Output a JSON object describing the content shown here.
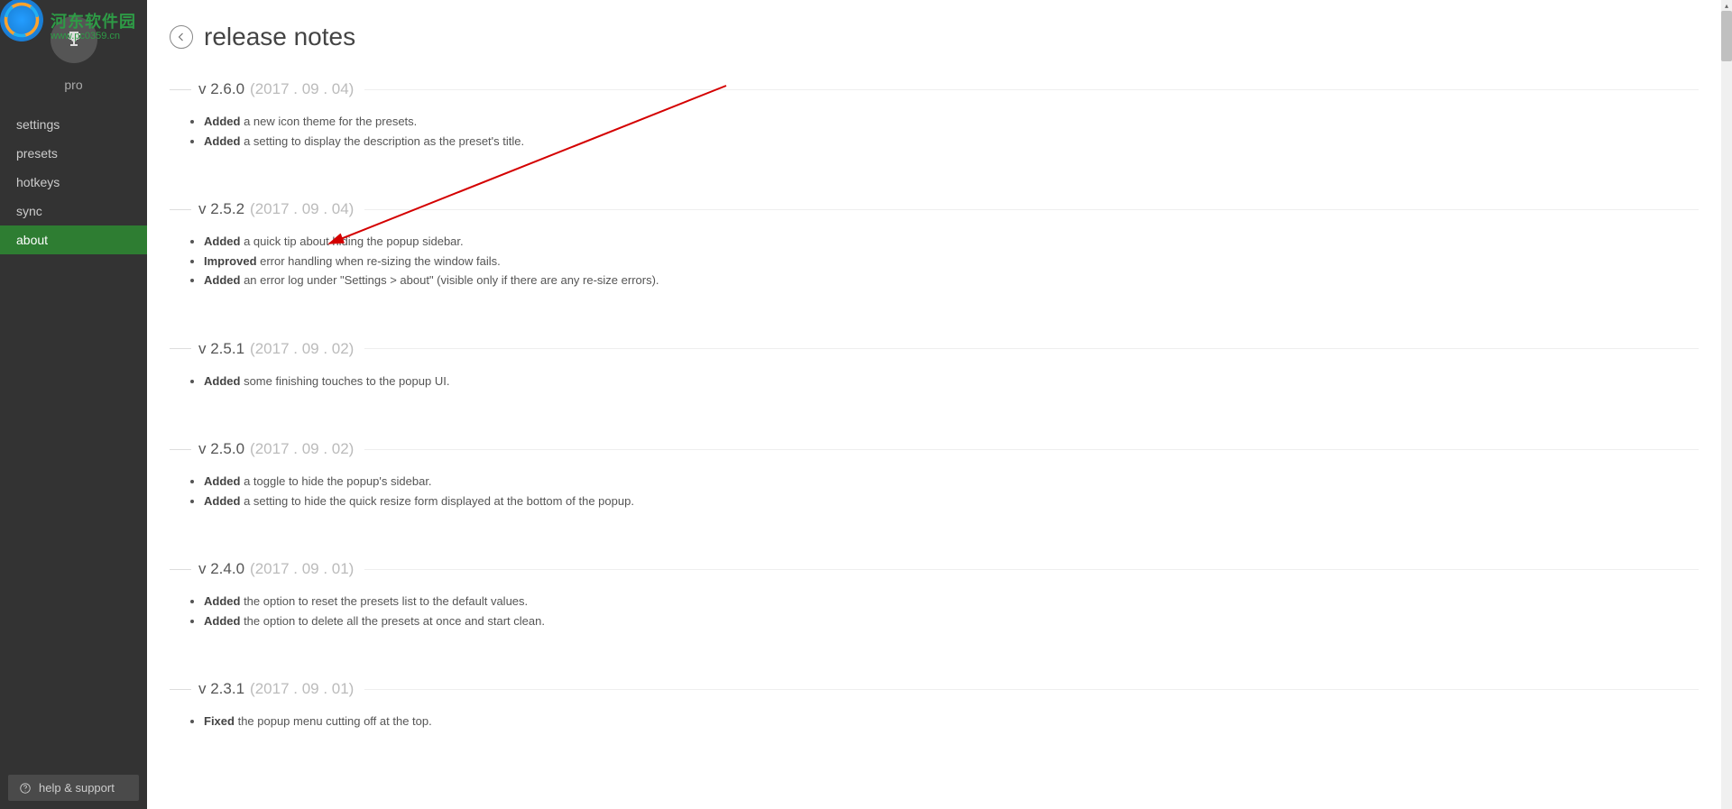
{
  "brand": {
    "cn": "河东软件园",
    "url": "www.pc0359.cn"
  },
  "sidebar": {
    "plan": "pro",
    "items": [
      {
        "label": "settings"
      },
      {
        "label": "presets"
      },
      {
        "label": "hotkeys"
      },
      {
        "label": "sync"
      },
      {
        "label": "about",
        "active": true
      }
    ],
    "help": "help & support"
  },
  "page": {
    "title": "release notes"
  },
  "releases": [
    {
      "version": "v 2.6.0",
      "date": "(2017 . 09 . 04)",
      "items": [
        {
          "tag": "Added",
          "text": " a new icon theme for the presets."
        },
        {
          "tag": "Added",
          "text": " a setting to display the description as the preset's title."
        }
      ]
    },
    {
      "version": "v 2.5.2",
      "date": "(2017 . 09 . 04)",
      "items": [
        {
          "tag": "Added",
          "text": " a quick tip about hiding the popup sidebar."
        },
        {
          "tag": "Improved",
          "text": " error handling when re-sizing the window fails."
        },
        {
          "tag": "Added",
          "text": " an error log under \"Settings > about\" (visible only if there are any re-size errors)."
        }
      ]
    },
    {
      "version": "v 2.5.1",
      "date": "(2017 . 09 . 02)",
      "items": [
        {
          "tag": "Added",
          "text": " some finishing touches to the popup UI."
        }
      ]
    },
    {
      "version": "v 2.5.0",
      "date": "(2017 . 09 . 02)",
      "items": [
        {
          "tag": "Added",
          "text": " a toggle to hide the popup's sidebar."
        },
        {
          "tag": "Added",
          "text": " a setting to hide the quick resize form displayed at the bottom of the popup."
        }
      ]
    },
    {
      "version": "v 2.4.0",
      "date": "(2017 . 09 . 01)",
      "items": [
        {
          "tag": "Added",
          "text": " the option to reset the presets list to the default values."
        },
        {
          "tag": "Added",
          "text": " the option to delete all the presets at once and start clean."
        }
      ]
    },
    {
      "version": "v 2.3.1",
      "date": "(2017 . 09 . 01)",
      "items": [
        {
          "tag": "Fixed",
          "text": " the popup menu cutting off at the top."
        }
      ]
    }
  ]
}
